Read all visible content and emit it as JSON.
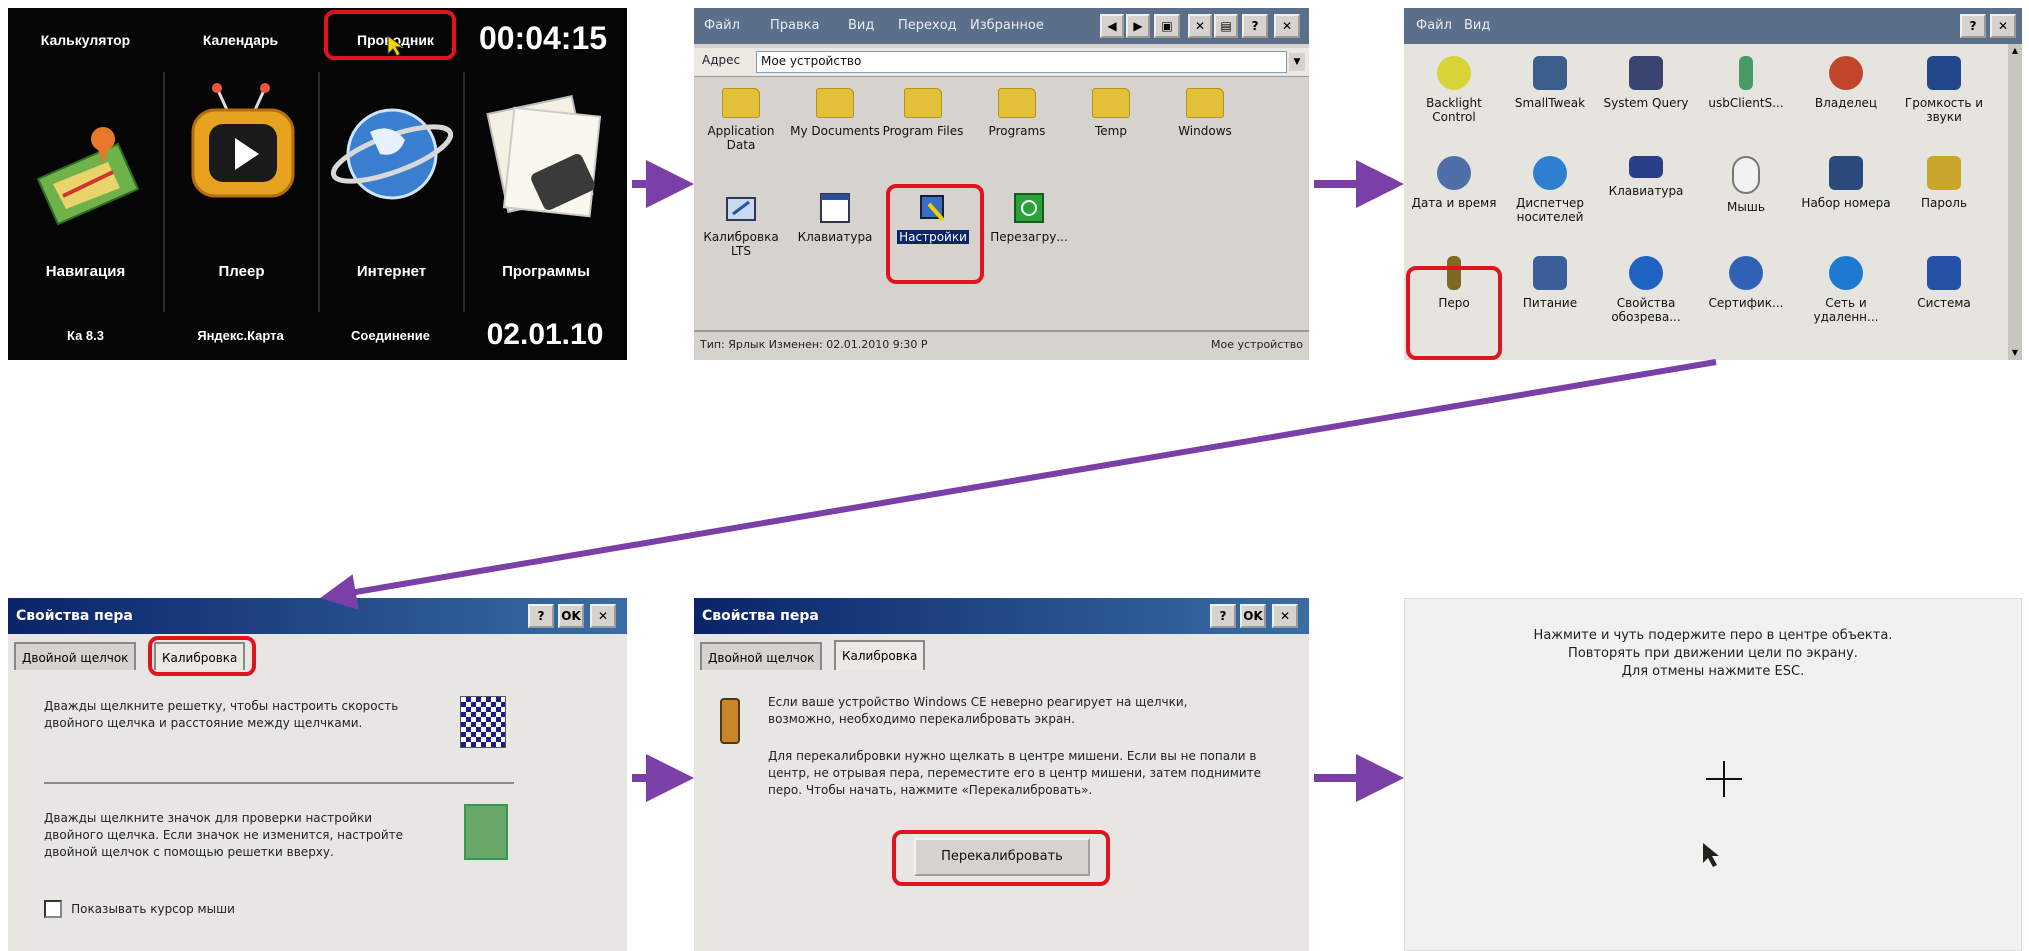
{
  "panel1": {
    "top_items": [
      "Калькулятор",
      "Календарь",
      "Проводник"
    ],
    "clock": "00:04:15",
    "tiles": [
      "Навигация",
      "Плеер",
      "Интернет",
      "Программы"
    ],
    "bottom_items": [
      "Ка 8.3",
      "Яндекс.Карта",
      "Соединение"
    ],
    "date": "02.01.10"
  },
  "panel2": {
    "menu": [
      "Файл",
      "Правка",
      "Вид",
      "Переход",
      "Избранное"
    ],
    "address_label": "Адрес",
    "address_value": "Мое устройство",
    "items": [
      {
        "label": "Application Data",
        "icon": "folder-icon"
      },
      {
        "label": "My Documents",
        "icon": "folder-icon"
      },
      {
        "label": "Program Files",
        "icon": "folder-icon"
      },
      {
        "label": "Programs",
        "icon": "folder-icon"
      },
      {
        "label": "Temp",
        "icon": "folder-icon"
      },
      {
        "label": "Windows",
        "icon": "folder-icon"
      },
      {
        "label": "Калибровка LTS",
        "icon": "calibration-icon"
      },
      {
        "label": "Клавиатура",
        "icon": "keyboard-window-icon"
      },
      {
        "label": "Настройки",
        "icon": "settings-shortcut-icon"
      },
      {
        "label": "Перезагру...",
        "icon": "reboot-icon"
      }
    ],
    "status_text": "Тип: Ярлык Изменен: 02.01.2010 9:30 P",
    "status_right": "Мое устройство"
  },
  "panel3": {
    "menu": [
      "Файл",
      "Вид"
    ],
    "items": [
      {
        "label": "Backlight Control",
        "icon": "bulb-icon"
      },
      {
        "label": "SmallTweak",
        "icon": "tweak-icon"
      },
      {
        "label": "System Query",
        "icon": "system-query-icon"
      },
      {
        "label": "usbClientS...",
        "icon": "usb-icon"
      },
      {
        "label": "Владелец",
        "icon": "owner-icon"
      },
      {
        "label": "Громкость и звуки",
        "icon": "volume-icon"
      },
      {
        "label": "Дата и время",
        "icon": "clock-icon"
      },
      {
        "label": "Диспетчер носителей",
        "icon": "storage-icon"
      },
      {
        "label": "Клавиатура",
        "icon": "keyboard-icon"
      },
      {
        "label": "Мышь",
        "icon": "mouse-icon"
      },
      {
        "label": "Набор номера",
        "icon": "dialing-icon"
      },
      {
        "label": "Пароль",
        "icon": "password-icon"
      },
      {
        "label": "Перо",
        "icon": "pen-icon"
      },
      {
        "label": "Питание",
        "icon": "power-icon"
      },
      {
        "label": "Свойства обозрева...",
        "icon": "browser-icon"
      },
      {
        "label": "Сертифик...",
        "icon": "certificate-icon"
      },
      {
        "label": "Сеть и удаленн...",
        "icon": "network-icon"
      },
      {
        "label": "Система",
        "icon": "system-icon"
      }
    ]
  },
  "panel4": {
    "title": "Свойства пера",
    "tabs": [
      "Двойной щелчок",
      "Калибровка"
    ],
    "text1": "Дважды щелкните решетку, чтобы настроить скорость двойного щелчка и расстояние между щелчками.",
    "text2": "Дважды щелкните значок для проверки настройки двойного щелчка. Если значок не изменится, настройте двойной щелчок с помощью решетки вверху.",
    "checkbox_label": "Показывать курсор мыши"
  },
  "panel5": {
    "title": "Свойства пера",
    "tabs": [
      "Двойной щелчок",
      "Калибровка"
    ],
    "text1": "Если ваше устройство Windows CE неверно реагирует на щелчки, возможно, необходимо перекалибровать экран.",
    "text2": "Для перекалибровки нужно щелкать в центре мишени. Если вы не попали в центр, не отрывая пера, переместите его в центр мишени, затем поднимите перо. Чтобы начать, нажмите «Перекалибровать».",
    "button": "Перекалибровать"
  },
  "panel6": {
    "line1": "Нажмите и чуть подержите перо в центре объекта.",
    "line2": "Повторять при движении цели по экрану.",
    "line3": "Для отмены нажмите ESC."
  },
  "colors": {
    "arrow": "#7b3fa8",
    "highlight": "#e0141e",
    "titlebar": "#0a246a",
    "window": "#d6d3ce"
  }
}
